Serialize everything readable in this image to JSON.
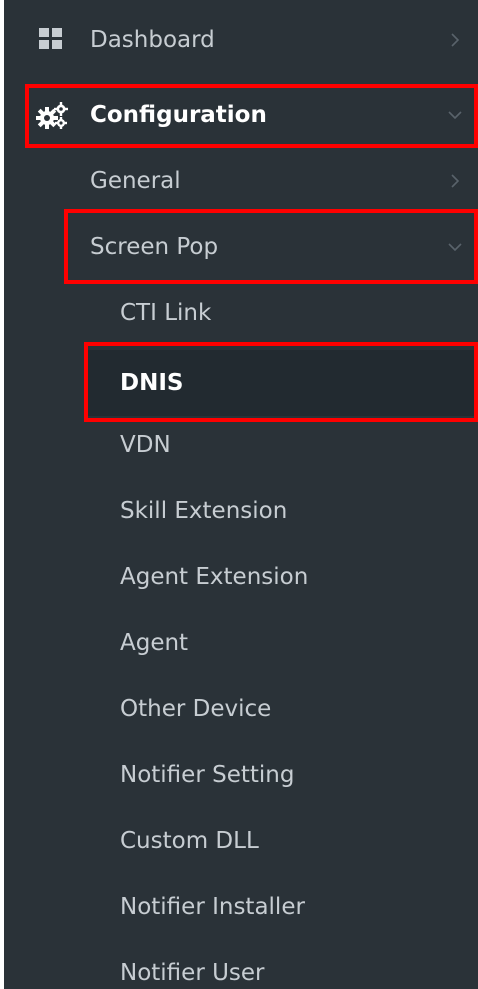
{
  "sidebar": {
    "dashboard": {
      "label": "Dashboard",
      "icon": "grid-icon",
      "chevron": "chevron-right-icon"
    },
    "configuration": {
      "label": "Configuration",
      "icon": "gears-icon",
      "chevron": "chevron-down-icon"
    },
    "general": {
      "label": "General",
      "chevron": "chevron-right-icon"
    },
    "screen_pop": {
      "label": "Screen Pop",
      "chevron": "chevron-down-icon"
    },
    "sub_items": [
      {
        "label": "CTI Link"
      },
      {
        "label": "DNIS"
      },
      {
        "label": "VDN"
      },
      {
        "label": "Skill Extension"
      },
      {
        "label": "Agent Extension"
      },
      {
        "label": "Agent"
      },
      {
        "label": "Other Device"
      },
      {
        "label": "Notifier Setting"
      },
      {
        "label": "Custom DLL"
      },
      {
        "label": "Notifier Installer"
      },
      {
        "label": "Notifier User"
      }
    ]
  },
  "colors": {
    "sidebar_bg": "#2a3238",
    "text": "#c7cdd2",
    "active_text": "#ffffff",
    "highlight": "#ff0000"
  }
}
